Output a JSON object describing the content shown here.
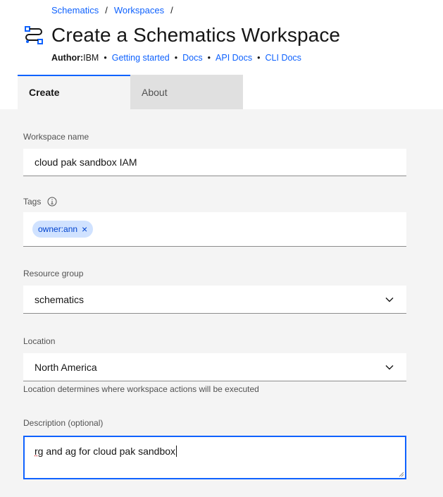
{
  "breadcrumb": {
    "items": [
      "Schematics",
      "Workspaces"
    ],
    "separator": "/"
  },
  "page": {
    "title": "Create a Schematics Workspace"
  },
  "meta": {
    "author_label": "Author:",
    "author_value": "IBM",
    "links": [
      "Getting started",
      "Docs",
      "API Docs",
      "CLI Docs"
    ],
    "separator": "•"
  },
  "tabs": [
    {
      "label": "Create",
      "active": true
    },
    {
      "label": "About",
      "active": false
    }
  ],
  "form": {
    "workspace_name": {
      "label": "Workspace name",
      "value": "cloud pak sandbox IAM"
    },
    "tags": {
      "label": "Tags",
      "items": [
        "owner:ann"
      ],
      "info_icon": "info-icon"
    },
    "resource_group": {
      "label": "Resource group",
      "value": "schematics"
    },
    "location": {
      "label": "Location",
      "value": "North America",
      "helper": "Location determines where workspace actions will be executed"
    },
    "description": {
      "label": "Description (optional)",
      "value_first_word": "rg",
      "value_rest": " and ag for cloud pak sandbox"
    }
  },
  "colors": {
    "accent": "#0f62fe",
    "tag_bg": "#d0e2ff",
    "tag_text": "#0043ce",
    "form_bg": "#f4f4f4",
    "inactive_tab": "#e0e0e0"
  }
}
